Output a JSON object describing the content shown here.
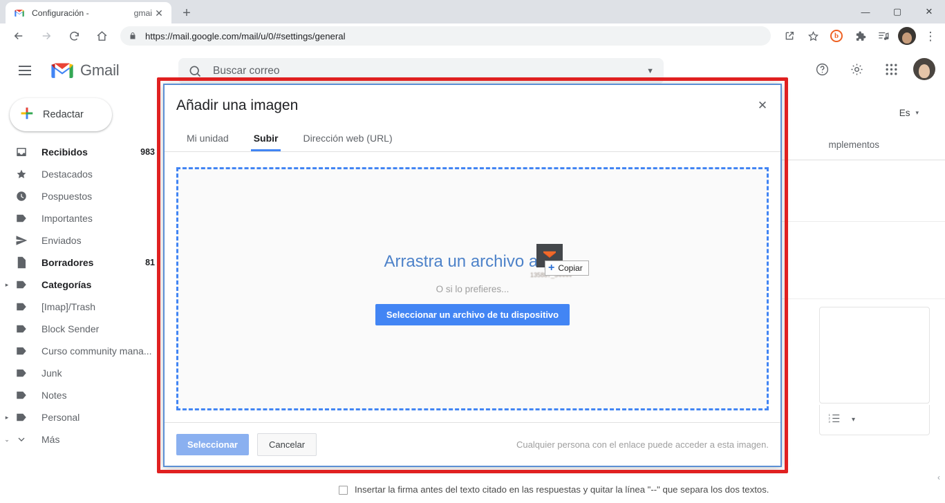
{
  "browser": {
    "tab": {
      "favicon": "gmail-icon",
      "title_start": "Configuración -",
      "title_end": "gmai",
      "close_label": "✕"
    },
    "new_tab_label": "+",
    "window_controls": {
      "minimize": "—",
      "maximize": "▢",
      "close": "✕"
    },
    "nav": {
      "back": "←",
      "forward": "→",
      "reload": "⟳",
      "home": "⌂"
    },
    "omnibox": {
      "url": "https://mail.google.com/mail/u/0/#settings/general",
      "lock_icon": "lock-icon"
    },
    "toolbar_right": {
      "share_icon": "open-in-new-icon",
      "bookmark_icon": "star-icon",
      "bitly_label": "b",
      "extensions_icon": "puzzle-icon",
      "reading_list_icon": "playlist-icon",
      "profile_icon": "chrome-profile-avatar",
      "menu_label": "⋮"
    }
  },
  "gmail": {
    "menu_icon": "hamburger-icon",
    "logo_text": "Gmail",
    "search": {
      "placeholder": "Buscar correo",
      "value": "",
      "icon": "search-icon",
      "options_icon": "chevron-down-icon"
    },
    "header_right": {
      "help": "?",
      "settings_icon": "gear-icon",
      "apps_icon": "apps-grid-icon",
      "avatar": "user-avatar"
    },
    "compose": {
      "label": "Redactar",
      "icon": "plus-icon"
    },
    "nav_items": [
      {
        "label": "Recibidos",
        "count": "983",
        "icon": "inbox-icon",
        "bold": true,
        "twisty": ""
      },
      {
        "label": "Destacados",
        "count": "",
        "icon": "star-icon",
        "bold": false,
        "twisty": ""
      },
      {
        "label": "Pospuestos",
        "count": "",
        "icon": "clock-icon",
        "bold": false,
        "twisty": ""
      },
      {
        "label": "Importantes",
        "count": "",
        "icon": "label-icon",
        "bold": false,
        "twisty": ""
      },
      {
        "label": "Enviados",
        "count": "",
        "icon": "send-icon",
        "bold": false,
        "twisty": ""
      },
      {
        "label": "Borradores",
        "count": "81",
        "icon": "draft-icon",
        "bold": true,
        "twisty": ""
      },
      {
        "label": "Categorías",
        "count": "",
        "icon": "label-icon",
        "bold": true,
        "twisty": "▸"
      },
      {
        "label": "[Imap]/Trash",
        "count": "",
        "icon": "label-icon",
        "bold": false,
        "twisty": ""
      },
      {
        "label": "Block Sender",
        "count": "",
        "icon": "label-icon",
        "bold": false,
        "twisty": ""
      },
      {
        "label": "Curso community mana...",
        "count": "",
        "icon": "label-icon",
        "bold": false,
        "twisty": ""
      },
      {
        "label": "Junk",
        "count": "",
        "icon": "label-icon",
        "bold": false,
        "twisty": ""
      },
      {
        "label": "Notes",
        "count": "",
        "icon": "label-icon",
        "bold": false,
        "twisty": ""
      },
      {
        "label": "Personal",
        "count": "",
        "icon": "label-icon",
        "bold": false,
        "twisty": "▸"
      },
      {
        "label": "Más",
        "count": "",
        "icon": "chevron-down-icon",
        "bold": false,
        "twisty": "⌄"
      }
    ]
  },
  "settings": {
    "language_pill": "Es",
    "language_caret": "▾",
    "tab_partial": "mplementos",
    "signature_list_icon": "numbered-list-icon",
    "signature_list_caret": "▾",
    "bottom_checkbox_label": "Insertar la firma antes del texto citado en las respuestas y quitar la línea \"--\" que separa los dos textos.",
    "scroll_chip": "‹"
  },
  "dialog": {
    "title": "Añadir una imagen",
    "close_label": "✕",
    "tabs": [
      {
        "label": "Mi unidad",
        "active": false
      },
      {
        "label": "Subir",
        "active": true
      },
      {
        "label": "Dirección web (URL)",
        "active": false
      }
    ],
    "dropzone": {
      "headline": "Arrastra un archivo aquí",
      "or_text": "O si lo prefieres...",
      "button_label": "Seleccionar un archivo de tu dispositivo"
    },
    "footer": {
      "select_label": "Seleccionar",
      "cancel_label": "Cancelar",
      "share_note": "Cualquier persona con el enlace puede acceder a esta imagen."
    }
  },
  "drag_ghost": {
    "badge_plus": "+",
    "badge_label": "Copiar",
    "file_name": "135887_54444",
    "thumb_icon": "image-file-icon"
  },
  "colors": {
    "annotation_red": "#e02020",
    "dialog_border_blue": "#5b8fd4",
    "accent_blue": "#4285f4",
    "dropzone_text": "#4d82c9"
  }
}
